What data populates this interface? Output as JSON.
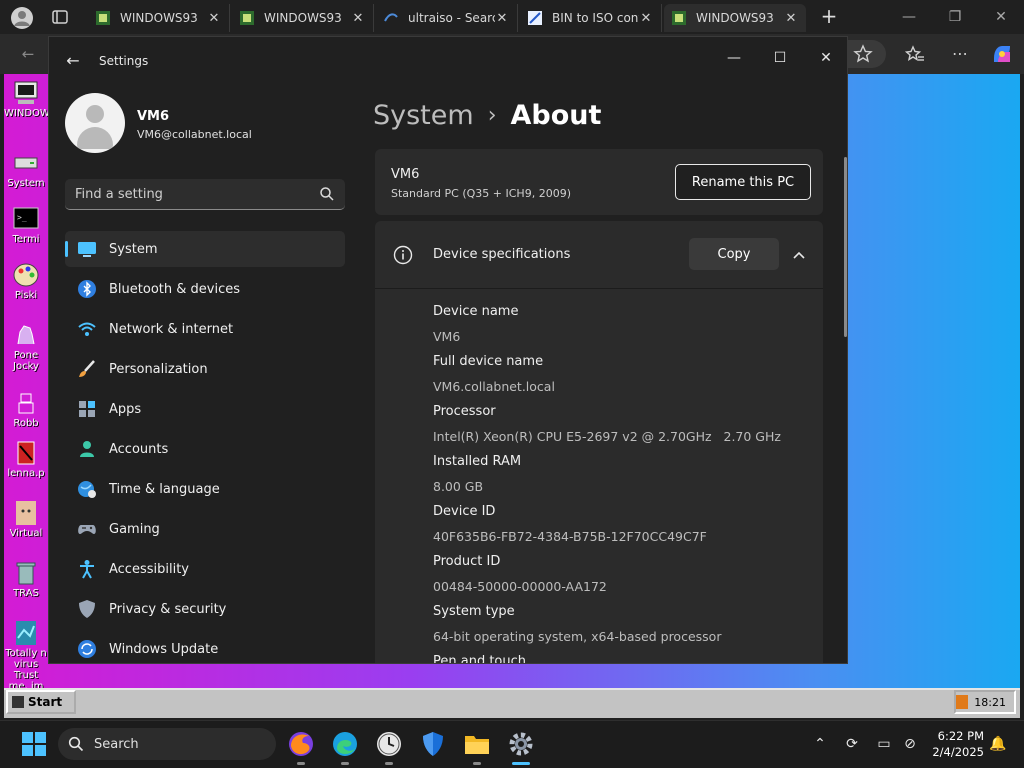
{
  "browser": {
    "tabs": [
      {
        "label": "WINDOWS93",
        "active": false
      },
      {
        "label": "WINDOWS93",
        "active": false
      },
      {
        "label": "ultraiso - Search",
        "active": false
      },
      {
        "label": "BIN to ISO conv",
        "active": false
      },
      {
        "label": "WINDOWS93",
        "active": true
      }
    ],
    "new_tab_label": "+",
    "close_glyph": "✕"
  },
  "desktop": {
    "icons": [
      {
        "label": "WINDOW",
        "icon": "computer-icon"
      },
      {
        "label": "System",
        "icon": "drive-icon"
      },
      {
        "label": "Termi",
        "icon": "terminal-icon"
      },
      {
        "label": "Piski",
        "icon": "palette-icon"
      },
      {
        "label": "Pone Jocky",
        "icon": "pony-icon"
      },
      {
        "label": "Robb",
        "icon": "robot-icon"
      },
      {
        "label": "lenna.p",
        "icon": "image-icon"
      },
      {
        "label": "Virtual",
        "icon": "face-icon"
      },
      {
        "label": "TRAS",
        "icon": "trash-icon"
      },
      {
        "label": "Totally n virus Trust me, im a",
        "icon": "virus-icon"
      }
    ],
    "start_label": "Start",
    "w93_clock": "18:21"
  },
  "settings": {
    "app_title": "Settings",
    "user": {
      "name": "VM6",
      "email": "VM6@collabnet.local"
    },
    "search_placeholder": "Find a setting",
    "nav": [
      {
        "label": "System",
        "icon": "monitor-icon",
        "active": true
      },
      {
        "label": "Bluetooth & devices",
        "icon": "bluetooth-icon",
        "active": false
      },
      {
        "label": "Network & internet",
        "icon": "wifi-icon",
        "active": false
      },
      {
        "label": "Personalization",
        "icon": "brush-icon",
        "active": false
      },
      {
        "label": "Apps",
        "icon": "apps-icon",
        "active": false
      },
      {
        "label": "Accounts",
        "icon": "person-icon",
        "active": false
      },
      {
        "label": "Time & language",
        "icon": "globe-clock-icon",
        "active": false
      },
      {
        "label": "Gaming",
        "icon": "gamepad-icon",
        "active": false
      },
      {
        "label": "Accessibility",
        "icon": "accessibility-icon",
        "active": false
      },
      {
        "label": "Privacy & security",
        "icon": "shield-icon",
        "active": false
      },
      {
        "label": "Windows Update",
        "icon": "update-icon",
        "active": false
      }
    ],
    "breadcrumb": {
      "parent": "System",
      "separator": "›",
      "current": "About"
    },
    "pc": {
      "name": "VM6",
      "model": "Standard PC (Q35 + ICH9, 2009)",
      "rename_label": "Rename this PC"
    },
    "specs": {
      "title": "Device specifications",
      "copy_label": "Copy",
      "rows": [
        {
          "label": "Device name",
          "value": "VM6"
        },
        {
          "label": "Full device name",
          "value": "VM6.collabnet.local"
        },
        {
          "label": "Processor",
          "value": "Intel(R) Xeon(R) CPU E5-2697 v2 @ 2.70GHz   2.70 GHz"
        },
        {
          "label": "Installed RAM",
          "value": "8.00 GB"
        },
        {
          "label": "Device ID",
          "value": "40F635B6-FB72-4384-B75B-12F70CC49C7F"
        },
        {
          "label": "Product ID",
          "value": "00484-50000-00000-AA172"
        },
        {
          "label": "System type",
          "value": "64-bit operating system, x64-based processor"
        },
        {
          "label": "Pen and touch",
          "value": ""
        }
      ]
    }
  },
  "taskbar": {
    "search_label": "Search",
    "time": "6:22 PM",
    "date": "2/4/2025"
  },
  "colors": {
    "accent": "#4cc2ff",
    "settings_bg": "#202020",
    "card_bg": "#2b2b2b"
  }
}
